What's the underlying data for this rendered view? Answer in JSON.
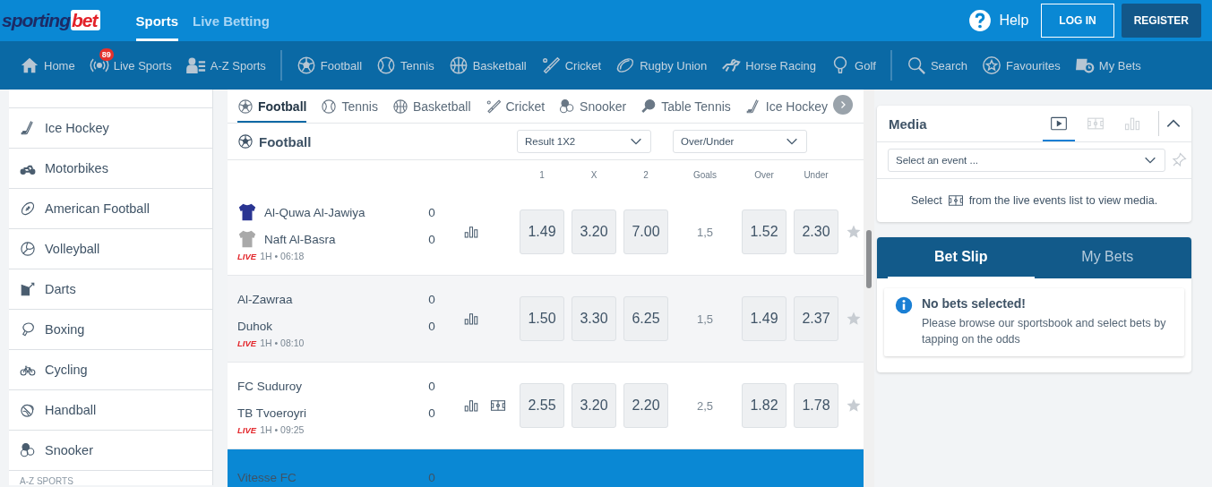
{
  "header": {
    "logo_parts": [
      {
        "text": "sporting",
        "color": "#1c2b66"
      },
      {
        "text": "bet",
        "color": "#e32229"
      }
    ],
    "tabs": [
      {
        "label": "Sports",
        "selected": true
      },
      {
        "label": "Live Betting",
        "selected": false
      }
    ],
    "help": "Help",
    "login": "LOG IN",
    "register": "REGISTER"
  },
  "nav": {
    "groups": [
      [
        {
          "kind": "home",
          "label": "Home"
        },
        {
          "kind": "live",
          "label": "Live Sports",
          "badge": "89"
        },
        {
          "kind": "az",
          "label": "A-Z Sports"
        }
      ],
      [
        {
          "kind": "football",
          "label": "Football"
        },
        {
          "kind": "tennis",
          "label": "Tennis"
        },
        {
          "kind": "basketball",
          "label": "Basketball"
        },
        {
          "kind": "cricket",
          "label": "Cricket"
        },
        {
          "kind": "rugby",
          "label": "Rugby Union"
        },
        {
          "kind": "horse",
          "label": "Horse Racing"
        },
        {
          "kind": "golf",
          "label": "Golf"
        }
      ],
      [
        {
          "kind": "search",
          "label": "Search"
        },
        {
          "kind": "favourites",
          "label": "Favourites"
        },
        {
          "kind": "mybets",
          "label": "My Bets"
        }
      ]
    ]
  },
  "sidebar": {
    "items": [
      {
        "kind": "hockey",
        "label": "Ice Hockey"
      },
      {
        "kind": "motorbike",
        "label": "Motorbikes"
      },
      {
        "kind": "amfootball",
        "label": "American Football"
      },
      {
        "kind": "volleyball",
        "label": "Volleyball"
      },
      {
        "kind": "darts",
        "label": "Darts"
      },
      {
        "kind": "boxing",
        "label": "Boxing"
      },
      {
        "kind": "cycling",
        "label": "Cycling"
      },
      {
        "kind": "handball",
        "label": "Handball"
      },
      {
        "kind": "snooker",
        "label": "Snooker"
      }
    ],
    "section_label": "A-Z SPORTS"
  },
  "sport_tabs": [
    {
      "kind": "football",
      "label": "Football",
      "selected": true
    },
    {
      "kind": "tennis",
      "label": "Tennis",
      "selected": false
    },
    {
      "kind": "basketball",
      "label": "Basketball",
      "selected": false
    },
    {
      "kind": "cricket",
      "label": "Cricket",
      "selected": false
    },
    {
      "kind": "snooker",
      "label": "Snooker",
      "selected": false
    },
    {
      "kind": "tabletennis",
      "label": "Table Tennis",
      "selected": false
    },
    {
      "kind": "hockey",
      "label": "Ice Hockey",
      "selected": false
    }
  ],
  "section": {
    "title": "Football",
    "markets": [
      "Result 1X2",
      "Over/Under"
    ],
    "columns": [
      "1",
      "X",
      "2",
      "Goals",
      "Over",
      "Under"
    ]
  },
  "events": [
    {
      "teams": [
        {
          "name": "Al-Quwa Al-Jawiya",
          "score": "0",
          "color": "#2a3592"
        },
        {
          "name": "Naft Al-Basra",
          "score": "0",
          "color": "#a9a9a9"
        }
      ],
      "live": "LIVE",
      "time": "1H • 06:18",
      "highlighted": false,
      "tracker": false,
      "odds": [
        "1.49",
        "3.20",
        "7.00"
      ],
      "goals": "1,5",
      "over_under": [
        "1.52",
        "2.30"
      ]
    },
    {
      "teams": [
        {
          "name": "Al-Zawraa",
          "score": "0"
        },
        {
          "name": "Duhok",
          "score": "0"
        }
      ],
      "live": "LIVE",
      "time": "1H • 08:10",
      "highlighted": true,
      "tracker": false,
      "odds": [
        "1.50",
        "3.30",
        "6.25"
      ],
      "goals": "1,5",
      "over_under": [
        "1.49",
        "2.37"
      ]
    },
    {
      "teams": [
        {
          "name": "FC Suduroy",
          "score": "0"
        },
        {
          "name": "TB Tvoeroyri",
          "score": "0"
        }
      ],
      "live": "LIVE",
      "time": "1H • 09:25",
      "highlighted": false,
      "tracker": true,
      "odds": [
        "2.55",
        "3.20",
        "2.20"
      ],
      "goals": "2,5",
      "over_under": [
        "1.82",
        "1.78"
      ]
    },
    {
      "teams": [
        {
          "name": "Vitesse FC",
          "score": "0"
        }
      ],
      "highlighted": false
    }
  ],
  "media": {
    "title": "Media",
    "tabs": [
      {
        "kind": "video",
        "selected": true
      },
      {
        "kind": "field",
        "selected": false
      },
      {
        "kind": "stats",
        "selected": false
      }
    ],
    "select": {
      "placeholder": "Select an event ..."
    },
    "message_before": "Select",
    "message_after": "from the live events list to view media."
  },
  "betslip": {
    "tabs": [
      {
        "label": "Bet Slip",
        "selected": true
      },
      {
        "label": "My Bets",
        "selected": false
      }
    ],
    "notice_title": "No bets selected!",
    "notice_text": "Please browse our sportsbook and select bets by tapping on the odds"
  }
}
